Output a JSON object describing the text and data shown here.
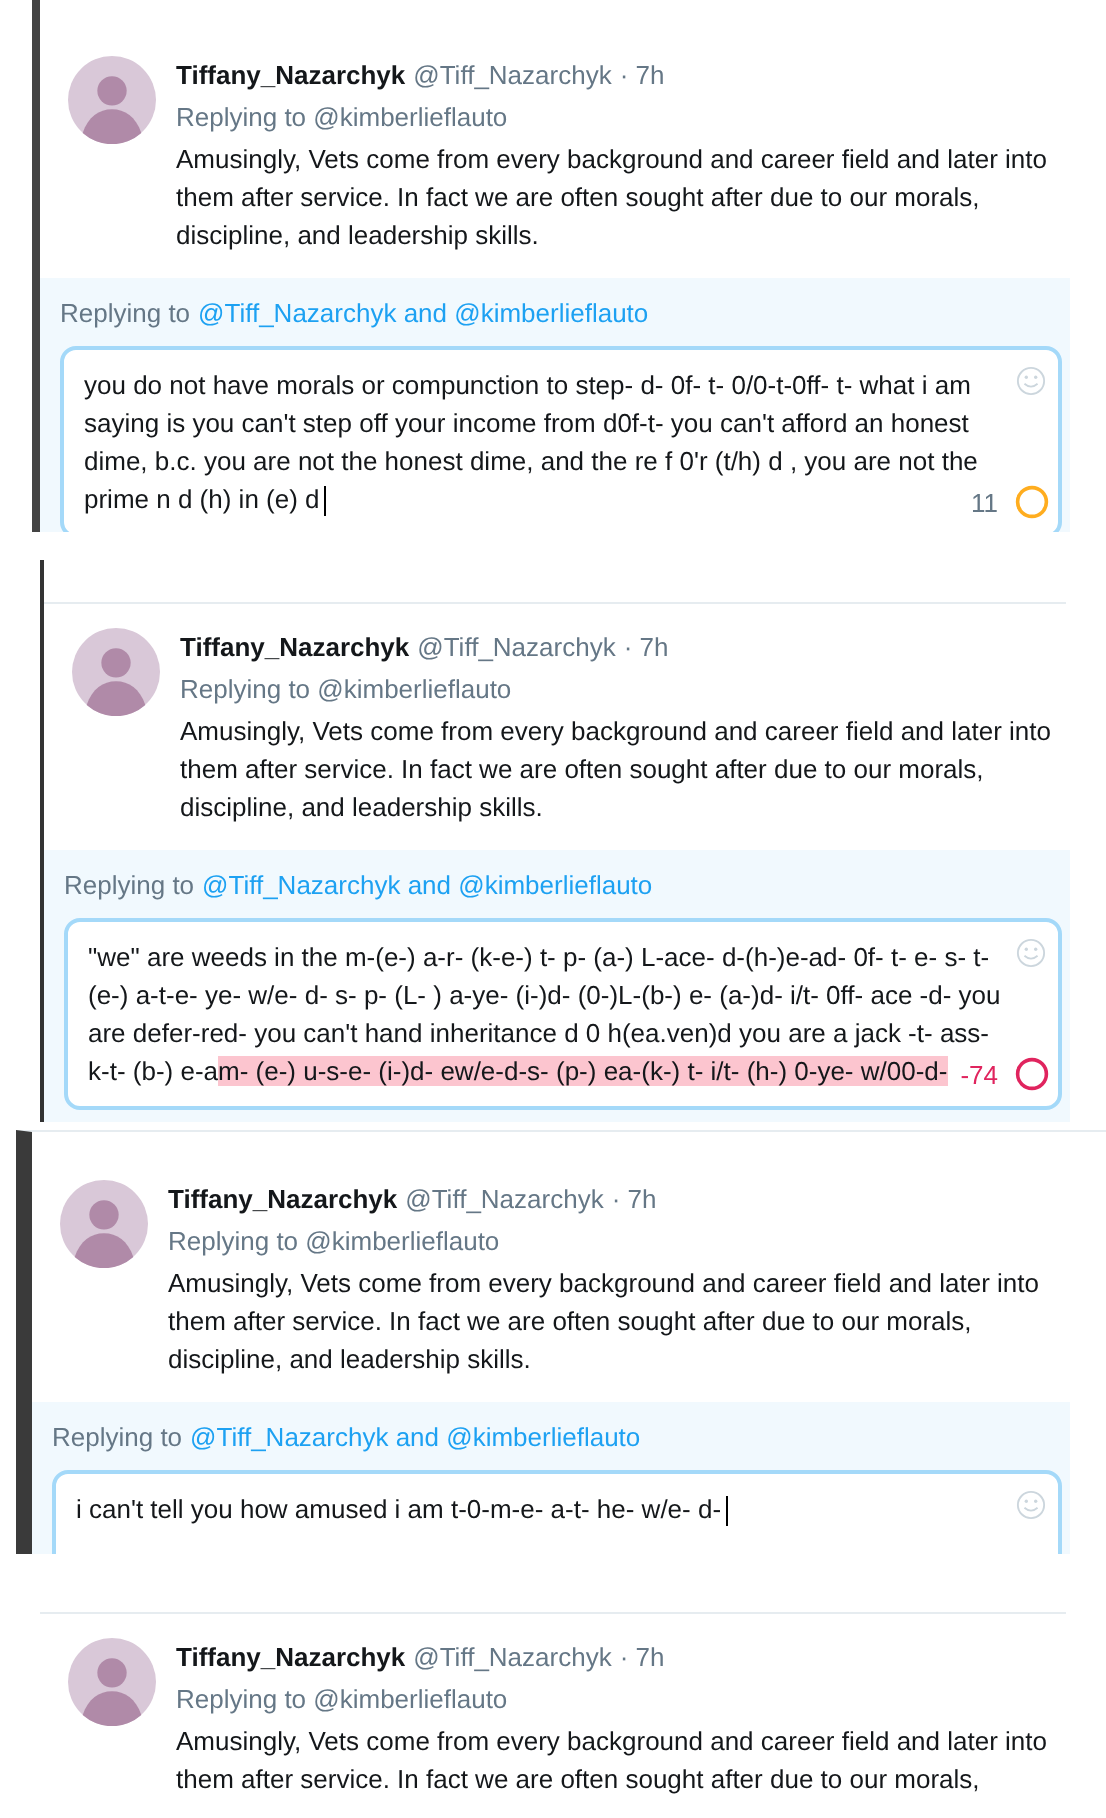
{
  "panels": [
    {
      "tweet": {
        "name": "Tiffany_Nazarchyk",
        "handle": "@Tiff_Nazarchyk",
        "time": "· 7h",
        "replying_to": "Replying to @kimberlieflauto",
        "text": "Amusingly, Vets come from every background and career field and later into them after service. In fact we are often sought after due to our morals, discipline, and leadership skills."
      },
      "compose": {
        "replying_label": "Replying to",
        "mentions": "@Tiff_Nazarchyk and @kimberlieflauto",
        "value": "you do not have morals or compunction to step- d- 0f- t- 0/0-t-0ff- t-  what i am saying is you can't step off your income from d0f-t-  you can't afford an honest dime, b.c. you are not the honest dime, and the re f 0'r (t/h) d , you are not the prime n d (h) in (e) d",
        "counter": "11",
        "over_limit": false
      }
    },
    {
      "tweet": {
        "name": "Tiffany_Nazarchyk",
        "handle": "@Tiff_Nazarchyk",
        "time": "· 7h",
        "replying_to": "Replying to @kimberlieflauto",
        "text": "Amusingly, Vets come from every background and career field and later into them after service. In fact we are often sought after due to our morals, discipline, and leadership skills."
      },
      "compose": {
        "replying_label": "Replying to",
        "mentions": "@Tiff_Nazarchyk and @kimberlieflauto",
        "value": "\"we\"  are weeds in the m-(e-) a-r- (k-e-) t- p- (a-) L-ace- d-(h-)e-ad- 0f- t- e- s- t- (e-) a-t-e- ye-  w/e- d-  s- p- (L- ) a-ye- (i-)d- (0-)L-(b-) e- (a-)d- i/t- 0ff- ace -d-  you are defer-red-   you can't hand inheritance d 0 h(ea.ven)d   you are a jack -t- ass-k-t- (b-) e-a",
        "overflow": "m- (e-) u-s-e- (i-)d- ew/e-d-s-  (p-) ea-(k-) t- i/t- (h-) 0-ye- w/00-d-",
        "counter": "-74",
        "over_limit": true
      }
    },
    {
      "tweet": {
        "name": "Tiffany_Nazarchyk",
        "handle": "@Tiff_Nazarchyk",
        "time": "· 7h",
        "replying_to": "Replying to @kimberlieflauto",
        "text": "Amusingly, Vets come from every background and career field and later into them after service. In fact we are often sought after due to our morals, discipline, and leadership skills."
      },
      "compose": {
        "replying_label": "Replying to",
        "mentions": "@Tiff_Nazarchyk and @kimberlieflauto",
        "value": "i can't tell you how amused i am t-0-m-e- a-t- he- w/e- d-"
      }
    },
    {
      "tweet": {
        "name": "Tiffany_Nazarchyk",
        "handle": "@Tiff_Nazarchyk",
        "time": "· 7h",
        "replying_to": "Replying to @kimberlieflauto",
        "text": "Amusingly, Vets come from every background and career field and later into them after service. In fact we are often sought after due to our morals,"
      }
    }
  ]
}
